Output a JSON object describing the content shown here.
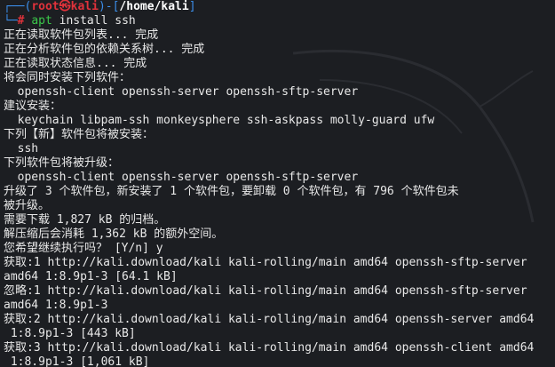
{
  "prompt": {
    "corner_top": "┌──(",
    "user": "root㉿kali",
    "mid": ")-[",
    "cwd": "/home/kali",
    "end": "]",
    "corner_bottom": "└─",
    "symbol": "#",
    "command_name": "apt",
    "command_args": "install ssh"
  },
  "output_lines": [
    "正在读取软件包列表... 完成",
    "正在分析软件包的依赖关系树... 完成",
    "正在读取状态信息... 完成",
    "将会同时安装下列软件：",
    "  openssh-client openssh-server openssh-sftp-server",
    "建议安装：",
    "  keychain libpam-ssh monkeysphere ssh-askpass molly-guard ufw",
    "下列【新】软件包将被安装：",
    "  ssh",
    "下列软件包将被升级：",
    "  openssh-client openssh-server openssh-sftp-server",
    "升级了 3 个软件包，新安装了 1 个软件包，要卸载 0 个软件包，有 796 个软件包未",
    "被升级。",
    "需要下载 1,827 kB 的归档。",
    "解压缩后会消耗 1,362 kB 的额外空间。",
    "您希望继续执行吗？ [Y/n] y",
    "获取:1 http://kali.download/kali kali-rolling/main amd64 openssh-sftp-server",
    "amd64 1:8.9p1-3 [64.1 kB]",
    "忽略:1 http://kali.download/kali kali-rolling/main amd64 openssh-sftp-server",
    "amd64 1:8.9p1-3",
    "获取:2 http://kali.download/kali kali-rolling/main amd64 openssh-server amd64",
    " 1:8.9p1-3 [443 kB]",
    "获取:3 http://kali.download/kali kali-rolling/main amd64 openssh-client amd64",
    " 1:8.9p1-3 [1,061 kB]"
  ],
  "colors": {
    "background": "#1c1e22",
    "text": "#e8e8e8",
    "prompt_frame": "#3b8eea",
    "prompt_user": "#e0323b",
    "command": "#3bc84a"
  }
}
